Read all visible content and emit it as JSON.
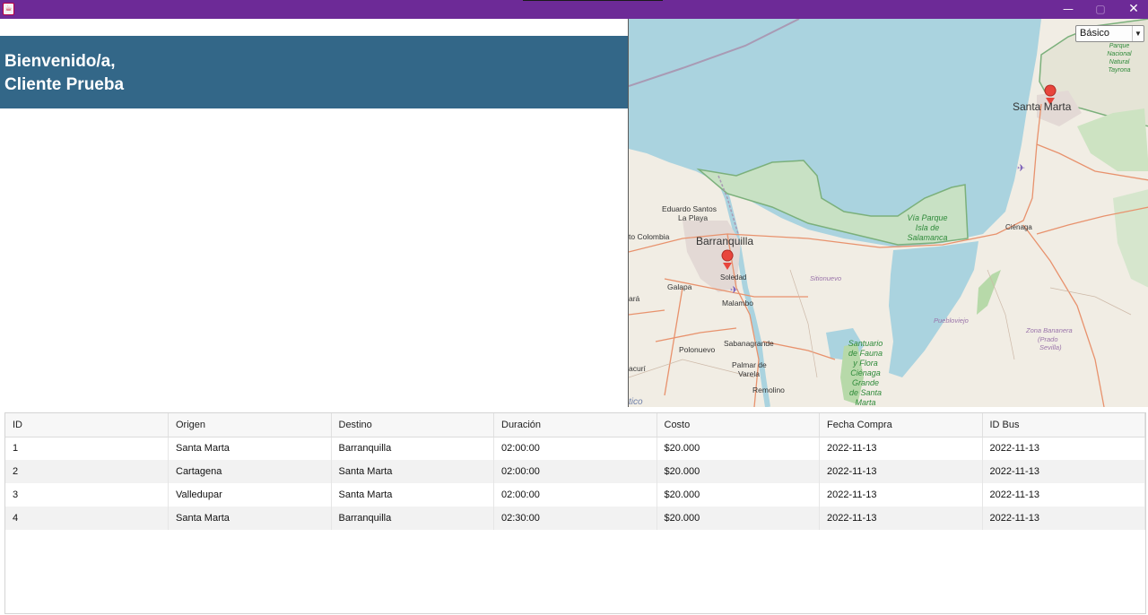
{
  "window": {
    "icon": "java-cup-icon",
    "minimize_glyph": "—",
    "maximize_glyph": "▢",
    "close_glyph": "✕"
  },
  "welcome": {
    "line1": "Bienvenido/a,",
    "line2": "Cliente Prueba"
  },
  "map": {
    "style_selector": "Básico",
    "labels": {
      "santa_marta": "Santa Marta",
      "barranquilla": "Barranquilla",
      "eduardo_santos": "Eduardo Santos",
      "la_playa": "La Playa",
      "puerto_colombia": "to Colombia",
      "soledad": "Soledad",
      "galapa": "Galapa",
      "malambo": "Malambo",
      "polonuevo": "Polonuevo",
      "sabanagrande": "Sabanagrande",
      "palmar": "Palmar de",
      "varela": "Varela",
      "remolino": "Remolino",
      "cienaga": "Ciénaga",
      "sitionuevo": "Sitionuevo",
      "pueblo_viejo": "Puebloviejo",
      "zona_bananera_1": "Zona Bananera",
      "zona_bananera_2": "(Prado",
      "zona_bananera_3": "Sevilla)",
      "via_parque_1": "Vía Parque",
      "via_parque_2": "Isla de",
      "via_parque_3": "Salamanca",
      "santuario_1": "Santuario",
      "santuario_2": "de Fauna",
      "santuario_3": "y Flora",
      "santuario_4": "Ciénaga",
      "santuario_5": "Grande",
      "santuario_6": "de Santa",
      "santuario_7": "Marta",
      "tayrona_1": "Parque",
      "tayrona_2": "Nacional",
      "tayrona_3": "Natural",
      "tayrona_4": "Tayrona",
      "baranoa": "ará",
      "tubara": "acurí",
      "atlantico": "tico"
    }
  },
  "trips_table": {
    "columns": [
      "ID",
      "Origen",
      "Destino",
      "Duración",
      "Costo",
      "Fecha Compra",
      "ID Bus"
    ],
    "rows": [
      [
        "1",
        "Santa Marta",
        "Barranquilla",
        "02:00:00",
        "$20.000",
        "2022-11-13",
        "2022-11-13"
      ],
      [
        "2",
        "Cartagena",
        "Santa Marta",
        "02:00:00",
        "$20.000",
        "2022-11-13",
        "2022-11-13"
      ],
      [
        "3",
        "Valledupar",
        "Santa Marta",
        "02:00:00",
        "$20.000",
        "2022-11-13",
        "2022-11-13"
      ],
      [
        "4",
        "Santa Marta",
        "Barranquilla",
        "02:30:00",
        "$20.000",
        "2022-11-13",
        "2022-11-13"
      ]
    ]
  },
  "colors": {
    "titlebar": "#6d2a97",
    "welcome_banner": "#336788",
    "sea": "#aad3df",
    "land": "#f1ede4",
    "marker": "#e8453c"
  }
}
